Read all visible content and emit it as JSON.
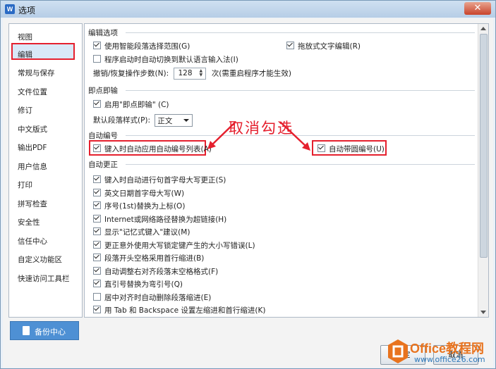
{
  "window": {
    "title": "选项",
    "close_glyph": "✕"
  },
  "sidebar": {
    "items": [
      {
        "label": "视图"
      },
      {
        "label": "编辑"
      },
      {
        "label": "常规与保存"
      },
      {
        "label": "文件位置"
      },
      {
        "label": "修订"
      },
      {
        "label": "中文版式"
      },
      {
        "label": "输出PDF"
      },
      {
        "label": "用户信息"
      },
      {
        "label": "打印"
      },
      {
        "label": "拼写检查"
      },
      {
        "label": "安全性"
      },
      {
        "label": "信任中心"
      },
      {
        "label": "自定义功能区"
      },
      {
        "label": "快速访问工具栏"
      }
    ],
    "selected_index": 1
  },
  "backup_button": {
    "label": "备份中心"
  },
  "sections": {
    "edit_options": {
      "title": "编辑选项",
      "smart_select": "使用智能段落选择范围(G)",
      "drag_edit": "拖放式文字编辑(R)",
      "auto_ime": "程序启动时自动切换到默认语言输入法(I)",
      "undo_label": "撤销/恢复操作步数(N):",
      "undo_value": "128",
      "undo_suffix": "次(需重启程序才能生效)"
    },
    "click_type": {
      "title": "即点即输",
      "enable": "启用\"即点即输\" (C)",
      "para_style_label": "默认段落样式(P):",
      "para_style_value": "正文"
    },
    "auto_number": {
      "title": "自动编号",
      "auto_list": "键入时自动应用自动编号列表(A)",
      "circled": "自动带圆编号(U)"
    },
    "auto_correct": {
      "title": "自动更正",
      "items": [
        "键入时自动进行句首字母大写更正(S)",
        "英文日期首字母大写(W)",
        "序号(1st)替换为上标(O)",
        "Internet或网络路径替换为超链接(H)",
        "显示\"记忆式键入\"建议(M)",
        "更正意外使用大写锁定键产生的大小写错误(L)",
        "段落开头空格采用首行缩进(B)",
        "自动调整右对齐段落末空格格式(F)",
        "直引号替换为弯引号(Q)",
        "居中对齐时自动删除段落缩进(E)",
        "用 Tab 和 Backspace 设置左缩进和首行缩进(K)"
      ],
      "checked": [
        true,
        true,
        true,
        true,
        true,
        true,
        true,
        true,
        true,
        false,
        true
      ]
    }
  },
  "annotation": "取消勾选",
  "buttons": {
    "ok": "确定",
    "cancel": "取消"
  },
  "watermark": {
    "brand": "Office教程网",
    "url": "www.office26.com"
  },
  "colors": {
    "highlight_red": "#e5202e",
    "accent_blue": "#4e90d4"
  }
}
